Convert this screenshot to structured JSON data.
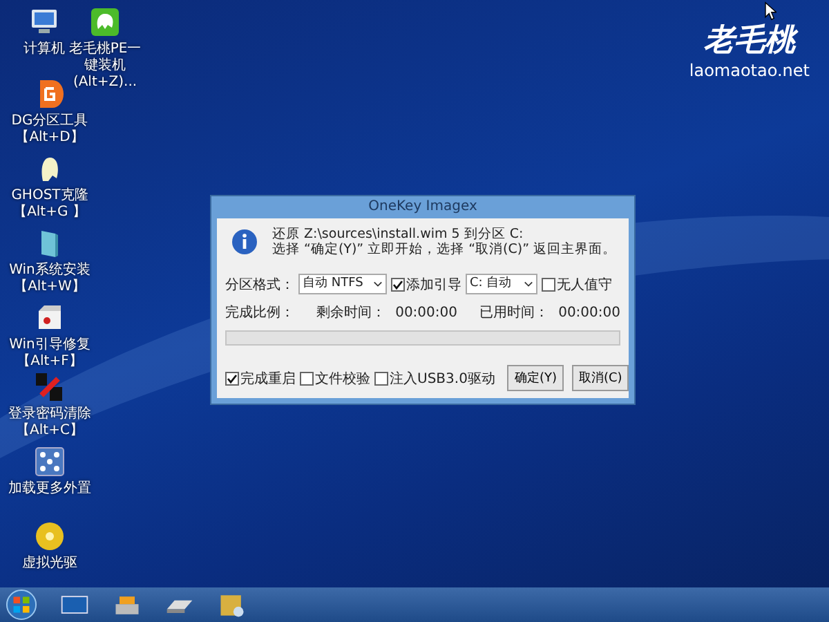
{
  "desktop": {
    "icons": [
      {
        "kind": "computer",
        "label": "计算机"
      },
      {
        "kind": "installer",
        "label": "老毛桃PE一键装机(Alt+Z)..."
      },
      {
        "kind": "partition",
        "label": "DG分区工具",
        "shortcut": "【Alt+D】"
      },
      {
        "kind": "ghost",
        "label": "GHOST克隆",
        "shortcut": "【Alt+G 】"
      },
      {
        "kind": "setup",
        "label": "Win系统安装",
        "shortcut": "【Alt+W】"
      },
      {
        "kind": "repair",
        "label": "Win引导修复",
        "shortcut": "【Alt+F】"
      },
      {
        "kind": "password",
        "label": "登录密码清除",
        "shortcut": "【Alt+C】"
      },
      {
        "kind": "network",
        "label": "加载更多外置"
      },
      {
        "kind": "disc",
        "label": "虚拟光驱"
      }
    ],
    "logo": {
      "name": "老毛桃",
      "url": "laomaotao.net"
    }
  },
  "dialog": {
    "title": "OneKey Imagex",
    "message": [
      "还原 Z:\\sources\\install.wim 5 到分区 C:",
      "选择 “确定(Y)” 立即开始，选择 “取消(C)” 返回主界面。"
    ],
    "format_label": "分区格式：",
    "format_select": "自动 NTFS",
    "add_boot": {
      "label": "添加引导",
      "checked": true
    },
    "boot_select": "C: 自动",
    "unattended": {
      "label": "无人值守",
      "checked": false
    },
    "progress_label": "完成比例：",
    "remaining_label": "剩余时间：",
    "remaining": "00:00:00",
    "elapsed_label": "已用时间：",
    "elapsed": "00:00:00",
    "progress": {
      "level": 0
    },
    "options": [
      {
        "label": "完成重启",
        "checked": true
      },
      {
        "label": "文件校验",
        "checked": false
      },
      {
        "label": "注入USB3.0驱动",
        "checked": false
      }
    ],
    "buttons": [
      "确定(Y)",
      "取消(C)"
    ]
  },
  "taskbar": {
    "items": [
      {
        "kind": "start"
      },
      {
        "kind": "monitor"
      },
      {
        "kind": "printer"
      },
      {
        "kind": "drive"
      },
      {
        "kind": "tools"
      }
    ]
  }
}
